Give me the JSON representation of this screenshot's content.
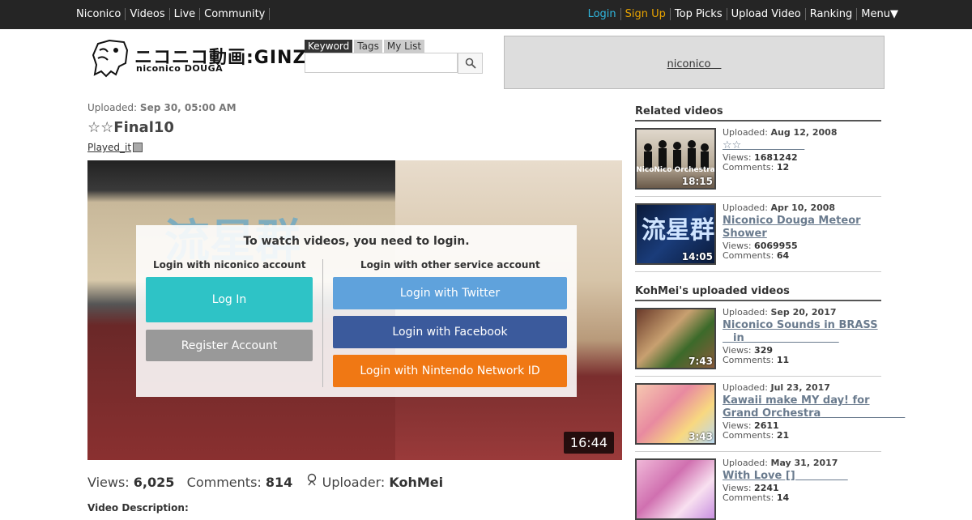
{
  "topbar": {
    "left_links": [
      "Niconico",
      "Videos",
      "Live",
      "Community"
    ],
    "login": "Login",
    "signup": "Sign Up",
    "right_links": [
      "Top Picks",
      "Upload Video",
      "Ranking",
      "Menu▼"
    ]
  },
  "logo": {
    "main": "ニコニコ動画:GINZA",
    "sub": "niconico DOUGA"
  },
  "search": {
    "tabs": [
      "Keyword",
      "Tags",
      "My List"
    ],
    "active_tab": 0,
    "value": "",
    "button_icon": "search-icon"
  },
  "ad": {
    "text": "niconico　"
  },
  "video": {
    "uploaded_label": "Uploaded:",
    "uploaded_date": "Sep 30, 05:00 AM",
    "title": "☆☆Final10",
    "played_it": "Played_it",
    "duration": "16:44",
    "stage_text": "流星群",
    "views_label": "Views:",
    "views": "6,025",
    "comments_label": "Comments:",
    "comments": "814",
    "uploader_label": "Uploader:",
    "uploader": "KohMei",
    "description_label": "Video Description:"
  },
  "login_overlay": {
    "heading": "To watch videos, you need to login.",
    "niconico_label": "Login with niconico account",
    "other_label": "Login with other service account",
    "login_button": "Log In",
    "register_button": "Register Account",
    "twitter_button": "Login with Twitter",
    "facebook_button": "Login with Facebook",
    "nintendo_button": "Login with Nintendo Network ID"
  },
  "colors": {
    "twitter": "#5fa2dc",
    "facebook": "#3b5a9c",
    "nintendo": "#f07814",
    "login": "#2ec3c6",
    "register": "#999999"
  },
  "sidebar": {
    "related_heading": "Related videos",
    "uploads_heading": "KohMei's uploaded videos",
    "related": [
      {
        "uploaded_label": "Uploaded:",
        "date": "Aug 12, 2008",
        "title": "☆☆　　　　　　",
        "views_label": "Views:",
        "views": "1681242",
        "comments_label": "Comments:",
        "comments": "12",
        "duration": "18:15",
        "thumb_text": "NicoNico Orchestra"
      },
      {
        "uploaded_label": "Uploaded:",
        "date": "Apr 10, 2008",
        "title": "Niconico Douga Meteor Shower",
        "views_label": "Views:",
        "views": "6069955",
        "comments_label": "Comments:",
        "comments": "64",
        "duration": "14:05",
        "thumb_text": "流星群"
      }
    ],
    "uploads": [
      {
        "uploaded_label": "Uploaded:",
        "date": "Sep 20, 2017",
        "title": "Niconico Sounds in BRASS 　in　　　　　　　　　",
        "views_label": "Views:",
        "views": "329",
        "comments_label": "Comments:",
        "comments": "11",
        "duration": "7:43"
      },
      {
        "uploaded_label": "Uploaded:",
        "date": "Jul 23, 2017",
        "title": "Kawaii make MY day! for Grand Orchestra　　　　　　　　",
        "views_label": "Views:",
        "views": "2611",
        "comments_label": "Comments:",
        "comments": "21",
        "duration": "3:43"
      },
      {
        "uploaded_label": "Uploaded:",
        "date": "May 31, 2017",
        "title": "With Love []　　　　　",
        "views_label": "Views:",
        "views": "2241",
        "comments_label": "Comments:",
        "comments": "14",
        "duration": ""
      }
    ]
  }
}
